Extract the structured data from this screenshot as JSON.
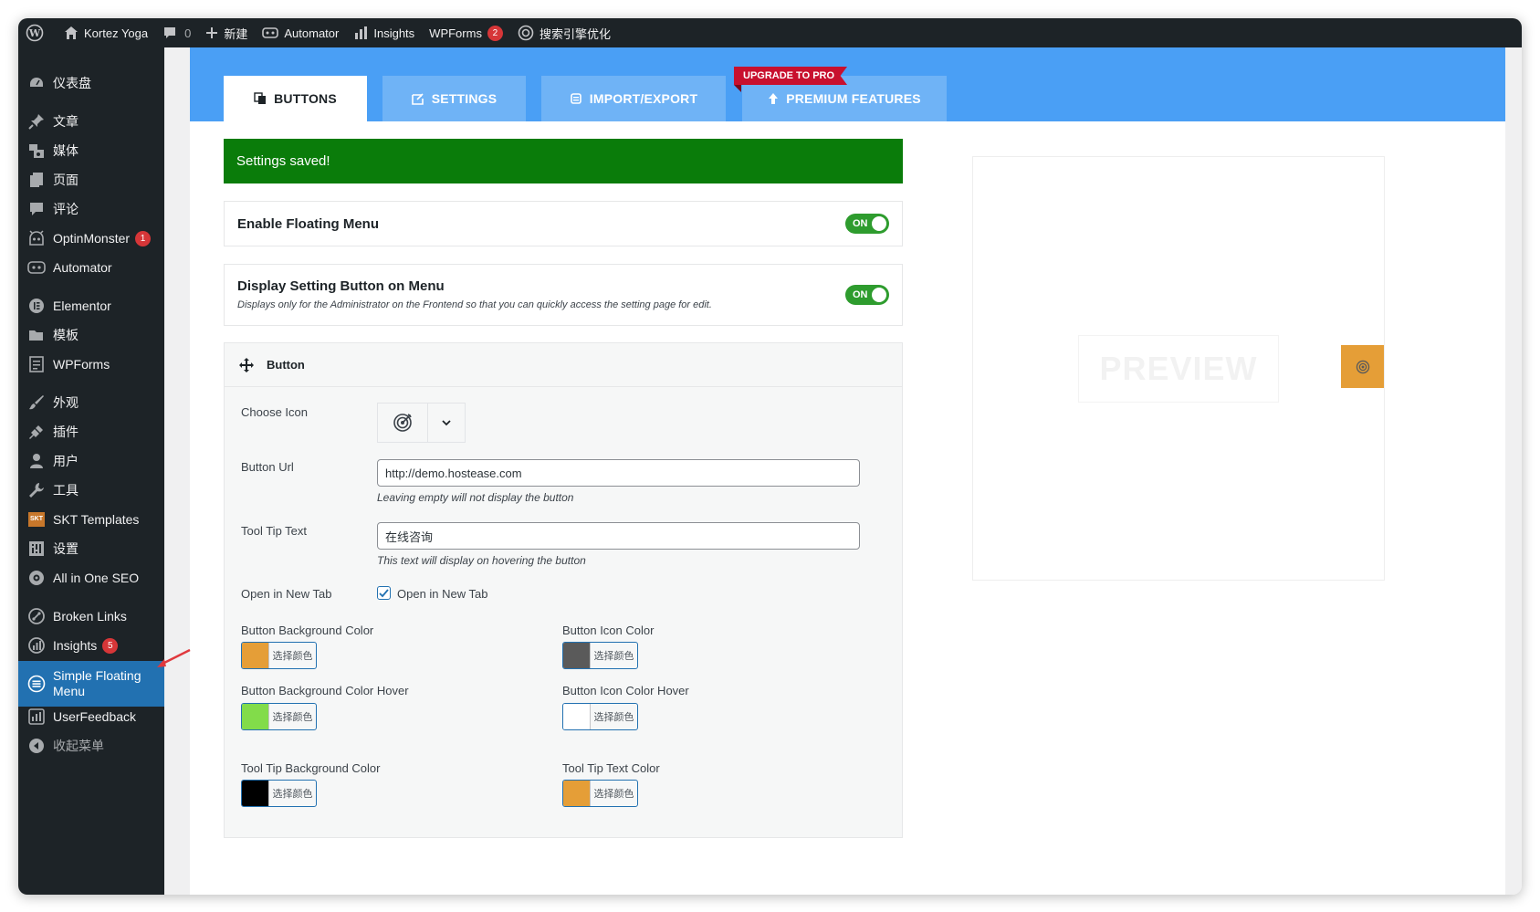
{
  "admin_bar": {
    "site_name": "Kortez Yoga",
    "comments_count": "0",
    "new_label": "新建",
    "automator_label": "Automator",
    "insights_label": "Insights",
    "wpforms_label": "WPForms",
    "wpforms_badge": "2",
    "seo_label": "搜索引擎优化"
  },
  "sidebar": {
    "items": [
      {
        "label": "仪表盘",
        "icon": "dashboard-icon"
      },
      {
        "label": "文章",
        "icon": "pin-icon"
      },
      {
        "label": "媒体",
        "icon": "media-icon"
      },
      {
        "label": "页面",
        "icon": "page-icon"
      },
      {
        "label": "评论",
        "icon": "comment-icon"
      },
      {
        "label": "OptinMonster",
        "icon": "optinmonster-icon",
        "badge": "1"
      },
      {
        "label": "Automator",
        "icon": "automator-icon"
      },
      {
        "label": "Elementor",
        "icon": "elementor-icon"
      },
      {
        "label": "模板",
        "icon": "folder-icon"
      },
      {
        "label": "WPForms",
        "icon": "wpforms-icon"
      },
      {
        "label": "外观",
        "icon": "brush-icon"
      },
      {
        "label": "插件",
        "icon": "plugin-icon"
      },
      {
        "label": "用户",
        "icon": "user-icon"
      },
      {
        "label": "工具",
        "icon": "wrench-icon"
      },
      {
        "label": "SKT Templates",
        "icon": "skt-icon"
      },
      {
        "label": "设置",
        "icon": "settings-icon"
      },
      {
        "label": "All in One SEO",
        "icon": "aioseo-icon"
      },
      {
        "label": "Broken Links",
        "icon": "broken-links-icon"
      },
      {
        "label": "Insights",
        "icon": "insights-icon",
        "badge": "5"
      },
      {
        "label": "Simple Floating Menu",
        "label_line1": "Simple Floating",
        "label_line2": "Menu",
        "icon": "floating-menu-icon",
        "active": true
      },
      {
        "label": "UserFeedback",
        "icon": "userfeedback-icon"
      },
      {
        "label": "收起菜单",
        "icon": "collapse-icon"
      }
    ]
  },
  "tabs": [
    {
      "label": "BUTTONS",
      "active": true
    },
    {
      "label": "SETTINGS"
    },
    {
      "label": "IMPORT/EXPORT"
    },
    {
      "label": "PREMIUM FEATURES"
    }
  ],
  "upgrade_ribbon": "UPGRADE TO PRO",
  "notice": "Settings saved!",
  "enable_menu": {
    "title": "Enable Floating Menu",
    "toggle": "ON"
  },
  "display_setting": {
    "title": "Display Setting Button on Menu",
    "desc": "Displays only for the Administrator on the Frontend so that you can quickly access the setting page for edit.",
    "toggle": "ON"
  },
  "button_section": {
    "title": "Button",
    "choose_icon_label": "Choose Icon",
    "icon": "target-icon",
    "url_label": "Button Url",
    "url_value": "http://demo.hostease.com",
    "url_hint": "Leaving empty will not display the button",
    "tooltip_label": "Tool Tip Text",
    "tooltip_value": "在线咨询",
    "tooltip_hint": "This text will display on hovering the button",
    "newtab_label": "Open in New Tab",
    "newtab_checkbox_label": "Open in New Tab",
    "newtab_checked": true,
    "color_button_text": "选择颜色",
    "colors": {
      "bg_label": "Button Background Color",
      "bg": "#e59e37",
      "icon_label": "Button Icon Color",
      "icon": "#5a5a5a",
      "bg_hover_label": "Button Background Color Hover",
      "bg_hover": "#82dc4a",
      "icon_hover_label": "Button Icon Color Hover",
      "icon_hover": "#ffffff",
      "tooltip_bg_label": "Tool Tip Background Color",
      "tooltip_bg": "#000000",
      "tooltip_text_label": "Tool Tip Text Color",
      "tooltip_text": "#e59e37"
    }
  },
  "preview": {
    "label": "PREVIEW"
  }
}
